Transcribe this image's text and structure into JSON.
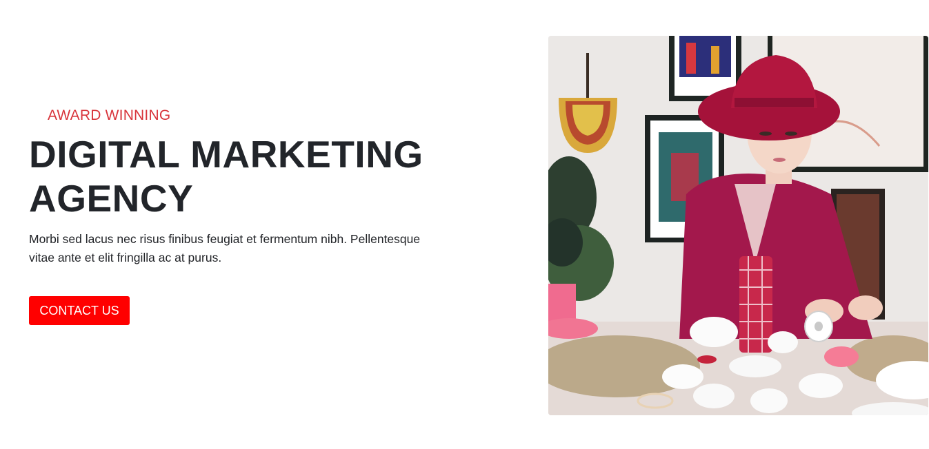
{
  "hero": {
    "eyebrow": "AWARD WINNING",
    "headline_line1": "DIGITAL MARKETING",
    "headline_line2": "AGENCY",
    "description": "Morbi sed lacus nec risus finibus feugiat et fermentum nibh. Pellentesque vitae ante et elit fringilla ac at purus.",
    "cta_label": "CONTACT US"
  },
  "colors": {
    "accent": "#d8343b",
    "button": "#ff0000",
    "heading": "#22252a"
  },
  "image": {
    "icon": "photo-icon",
    "subject": "woman in red hat crafting at a table"
  }
}
